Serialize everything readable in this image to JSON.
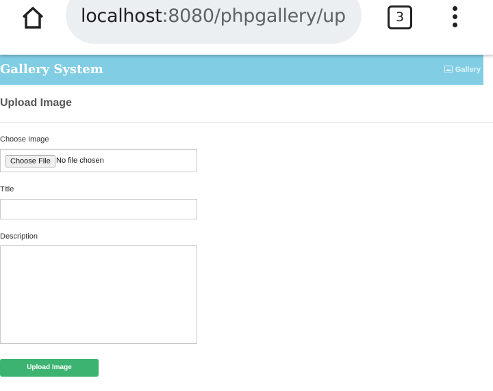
{
  "browser": {
    "url_host": "localhost",
    "url_path": ":8080/phpgallery/up",
    "tab_count": "3"
  },
  "navbar": {
    "brand": "Gallery System",
    "gallery_link": "Gallery"
  },
  "page": {
    "title": "Upload Image"
  },
  "form": {
    "image_label": "Choose Image",
    "file_button": "Choose File",
    "file_status": "No file chosen",
    "title_label": "Title",
    "title_value": "",
    "description_label": "Description",
    "description_value": "",
    "submit_label": "Upload Image"
  },
  "colors": {
    "navbar": "#81cde4",
    "submit": "#3cb371"
  }
}
